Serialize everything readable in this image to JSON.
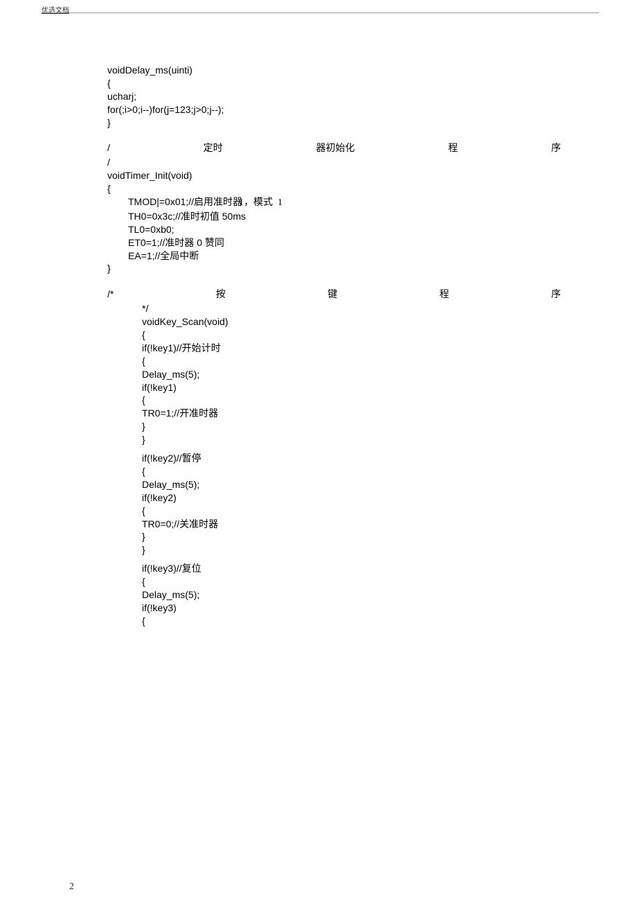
{
  "header": {
    "link": "优选文档"
  },
  "delay_fn": {
    "l1": "voidDelay_ms(uinti)",
    "l2": "{",
    "l3": "ucharj;",
    "l4": "for(;i>0;i--)for(j=123;j>0;j--);",
    "l5": "}"
  },
  "timer_comment": {
    "slash1": "/",
    "c1": "定时",
    "c2": "器初始化",
    "c3": "程",
    "c4": "序",
    "slash2": "/"
  },
  "timer_fn": {
    "l1": "voidTimer_Init(void)",
    "l2": "{",
    "l3a": "TMOD|=0x01;//启用准时器",
    "l3b": "1，模式",
    "l3c": "1",
    "l4": "TH0=0x3c;//准时初值 50ms",
    "l5": "TL0=0xb0;",
    "l6": "ET0=1;//准时器 0 赞同",
    "l7": "EA=1;//全局中断",
    "l8": "}"
  },
  "key_comment": {
    "open": "/*",
    "c1": "按",
    "c2": "键",
    "c3": "程",
    "c4": "序",
    "close": "*/"
  },
  "key_fn": {
    "l1": "voidKey_Scan(void)",
    "l2": "{",
    "k1": {
      "a": "if(!key1)//开始计时",
      "b": "{",
      "c": "Delay_ms(5);",
      "d": "if(!key1)",
      "e": "{",
      "f": "TR0=1;//开准时器",
      "g": "}",
      "h": "}"
    },
    "k2": {
      "a": "if(!key2)//暂停",
      "b": "{",
      "c": "Delay_ms(5);",
      "d": "if(!key2)",
      "e": "{",
      "f": "TR0=0;//关准时器",
      "g": "}",
      "h": "}"
    },
    "k3": {
      "a": "if(!key3)//复位",
      "b": "{",
      "c": "Delay_ms(5);",
      "d": "if(!key3)",
      "e": "{"
    }
  },
  "page_number": "2"
}
